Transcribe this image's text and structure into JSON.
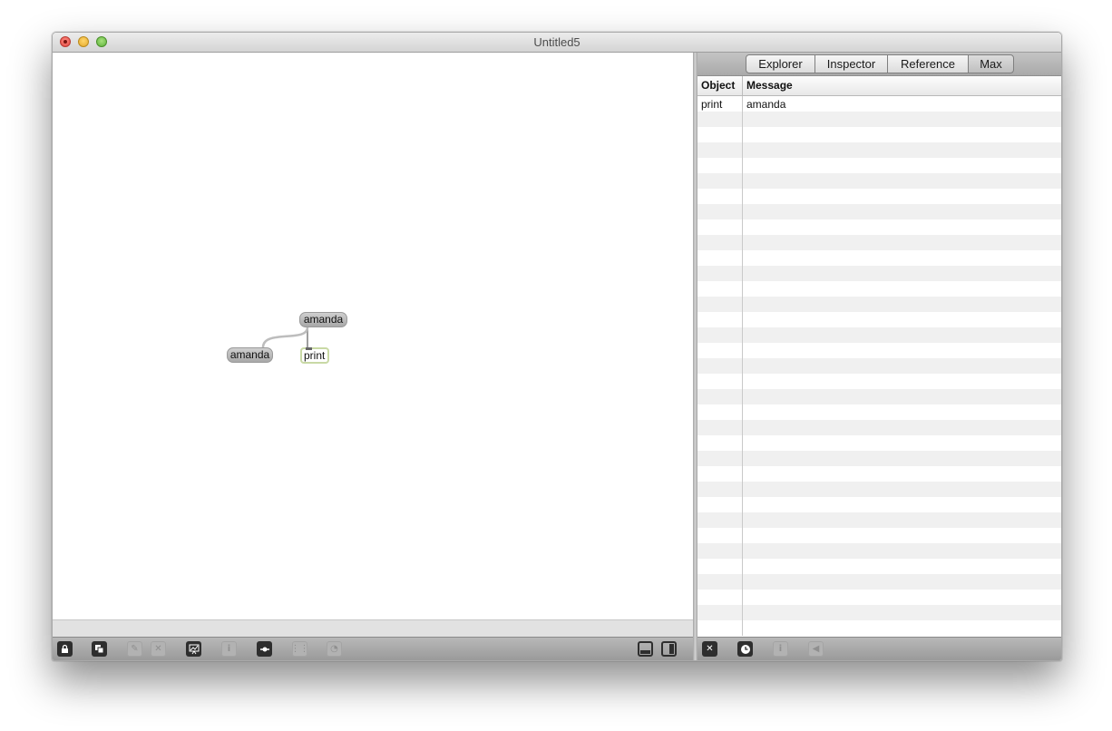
{
  "window": {
    "title": "Untitled5"
  },
  "patcher": {
    "objects": [
      {
        "kind": "message",
        "text": "amanda"
      },
      {
        "kind": "message",
        "text": "amanda"
      },
      {
        "kind": "object",
        "text": "print"
      }
    ]
  },
  "patch_toolbar": {
    "buttons": [
      "lock-icon",
      "presentation-icon",
      "paint-icon",
      "delete-icon",
      "chart-icon",
      "info-icon",
      "slider-icon",
      "grid-icon",
      "clock-icon",
      "bottom-panel-icon",
      "right-panel-icon"
    ]
  },
  "sidebar": {
    "tabs": [
      "Explorer",
      "Inspector",
      "Reference",
      "Max"
    ],
    "selected_tab": "Max",
    "console": {
      "columns": {
        "object": "Object",
        "message": "Message"
      },
      "rows": [
        {
          "object": "print",
          "message": "amanda"
        }
      ]
    },
    "toolbar": {
      "buttons": [
        "clear-icon",
        "clock-icon",
        "info-icon",
        "back-arrow-icon"
      ]
    }
  }
}
